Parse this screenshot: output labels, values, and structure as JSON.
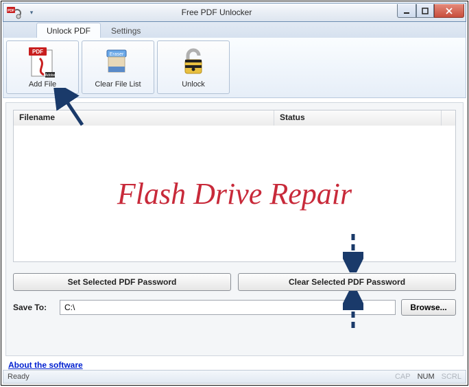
{
  "title": "Free PDF Unlocker",
  "tabs": {
    "unlock": "Unlock PDF",
    "settings": "Settings"
  },
  "ribbon": {
    "add_file": "Add File",
    "clear_list": "Clear File List",
    "unlock": "Unlock"
  },
  "grid": {
    "col_filename": "Filename",
    "col_status": "Status"
  },
  "watermark": "Flash Drive Repair",
  "buttons": {
    "set_pw": "Set Selected PDF Password",
    "clear_pw": "Clear Selected PDF Password",
    "browse": "Browse..."
  },
  "save": {
    "label": "Save To:",
    "value": "C:\\"
  },
  "about_link": "About the software",
  "status": {
    "ready": "Ready",
    "cap": "CAP",
    "num": "NUM",
    "scrl": "SCRL"
  }
}
